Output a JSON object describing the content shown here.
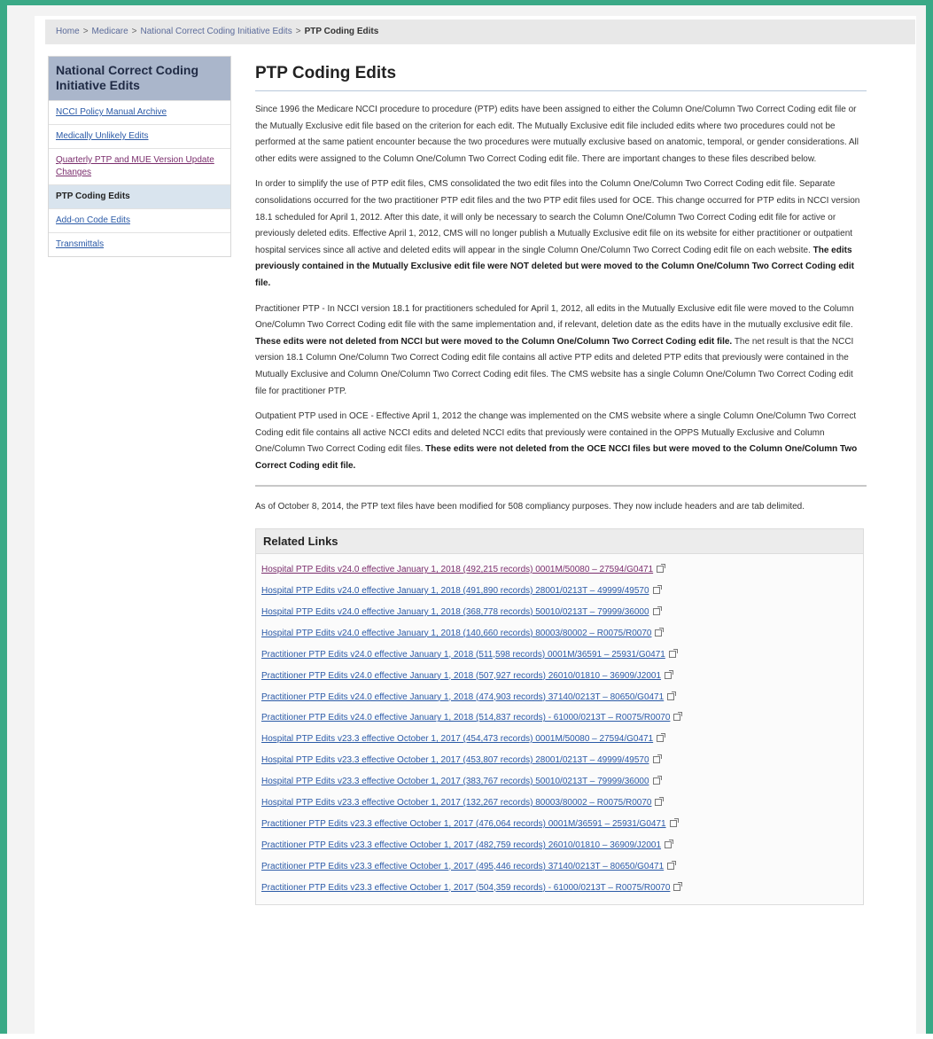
{
  "breadcrumb": {
    "home": "Home",
    "medicare": "Medicare",
    "ncci": "National Correct Coding Initiative Edits",
    "current": "PTP Coding Edits",
    "separator": ">"
  },
  "sidebar": {
    "heading": "National Correct Coding Initiative Edits",
    "items": [
      {
        "label": "NCCI Policy Manual Archive"
      },
      {
        "label": "Medically Unlikely Edits"
      },
      {
        "label": "Quarterly PTP and MUE Version Update Changes"
      },
      {
        "label": "PTP Coding Edits"
      },
      {
        "label": "Add-on Code Edits"
      },
      {
        "label": "Transmittals"
      }
    ]
  },
  "main": {
    "title": "PTP Coding Edits",
    "p1": "Since 1996 the Medicare NCCI procedure to procedure (PTP) edits have been assigned to either the Column One/Column Two Correct Coding edit file or the Mutually Exclusive edit file based on the criterion for each edit. The Mutually Exclusive edit file included edits where two procedures could not be performed at the same patient encounter because the two procedures were mutually exclusive based on anatomic, temporal, or gender considerations. All other edits were assigned to the Column One/Column Two Correct Coding edit file. There are important changes to these files described below.",
    "p2_text": "In order to simplify the use of PTP edit files, CMS consolidated the two edit files into the Column One/Column Two Correct Coding edit file. Separate consolidations occurred for the two practitioner PTP edit files and the two PTP edit files used for OCE. This change occurred for PTP edits in NCCI version 18.1 scheduled for April 1, 2012. After this date, it will only be necessary to search the Column One/Column Two Correct Coding edit file for active or previously deleted edits. Effective April 1, 2012, CMS will no longer publish a Mutually Exclusive edit file on its website for either practitioner or outpatient hospital services since all active and deleted edits will appear in the single Column One/Column Two Correct Coding edit file on each website.",
    "p2_bold": "The edits previously contained in the Mutually Exclusive edit file were NOT deleted but were moved to the Column One/Column Two Correct Coding edit file.",
    "p3_text1": "Practitioner PTP - In NCCI version 18.1 for practitioners scheduled for April 1, 2012, all edits in the Mutually Exclusive edit file were moved to the Column One/Column Two Correct Coding edit file with the same implementation and, if relevant, deletion date as the edits have in the mutually exclusive edit file.",
    "p3_bold": "These edits were not deleted from NCCI but were moved to the Column One/Column Two Correct Coding edit file.",
    "p3_text2": "The net result is that the NCCI version 18.1 Column One/Column Two Correct Coding edit file contains all active PTP edits and deleted PTP edits that previously were contained in the Mutually Exclusive and Column One/Column Two Correct Coding edit files. The CMS website has a single Column One/Column Two Correct Coding edit file for practitioner PTP.",
    "p4_text": "Outpatient PTP used in OCE - Effective April 1, 2012 the change was implemented on the CMS website where a single Column One/Column Two Correct Coding edit file contains all active NCCI edits and deleted NCCI edits that previously were contained in the OPPS Mutually Exclusive and Column One/Column Two Correct Coding edit files.",
    "p4_bold": "These edits were not deleted from the OCE NCCI files but were moved to the Column One/Column Two Correct Coding edit file.",
    "p5": "As of October 8, 2014, the PTP text files have been modified for 508 compliancy purposes. They now include headers and are tab delimited."
  },
  "related": {
    "heading": "Related Links",
    "links": [
      {
        "label": "Hospital PTP Edits v24.0 effective January 1, 2018 (492,215 records) 0001M/50080 – 27594/G0471",
        "visited": true
      },
      {
        "label": "Hospital PTP Edits v24.0 effective January 1, 2018 (491,890 records) 28001/0213T – 49999/49570",
        "visited": false
      },
      {
        "label": "Hospital PTP Edits v24.0 effective January 1, 2018 (368,778 records) 50010/0213T – 79999/36000",
        "visited": false
      },
      {
        "label": "Hospital PTP Edits v24.0 effective January 1, 2018 (140,660 records) 80003/80002 – R0075/R0070",
        "visited": false
      },
      {
        "label": "Practitioner PTP Edits v24.0 effective January 1, 2018 (511,598 records) 0001M/36591 – 25931/G0471",
        "visited": false
      },
      {
        "label": "Practitioner PTP Edits v24.0 effective January 1, 2018 (507,927 records) 26010/01810 – 36909/J2001",
        "visited": false
      },
      {
        "label": "Practitioner PTP Edits v24.0 effective January 1, 2018 (474,903 records) 37140/0213T – 80650/G0471",
        "visited": false
      },
      {
        "label": "Practitioner PTP Edits v24.0 effective January 1, 2018 (514,837 records) - 61000/0213T – R0075/R0070",
        "visited": false
      },
      {
        "label": "Hospital PTP Edits v23.3 effective October 1, 2017 (454,473 records) 0001M/50080 – 27594/G0471",
        "visited": false
      },
      {
        "label": "Hospital PTP Edits v23.3 effective October 1, 2017 (453,807 records) 28001/0213T – 49999/49570",
        "visited": false
      },
      {
        "label": "Hospital PTP Edits v23.3 effective October 1, 2017 (383,767 records) 50010/0213T – 79999/36000",
        "visited": false
      },
      {
        "label": "Hospital PTP Edits v23.3 effective October 1, 2017 (132,267 records) 80003/80002 – R0075/R0070",
        "visited": false
      },
      {
        "label": "Practitioner PTP Edits v23.3 effective October 1, 2017 (476,064 records) 0001M/36591 – 25931/G0471",
        "visited": false
      },
      {
        "label": "Practitioner PTP Edits v23.3 effective October 1, 2017 (482,759 records) 26010/01810 – 36909/J2001",
        "visited": false
      },
      {
        "label": "Practitioner PTP Edits v23.3 effective October 1, 2017 (495,446 records) 37140/0213T – 80650/G0471",
        "visited": false
      },
      {
        "label": "Practitioner PTP Edits v23.3 effective October 1, 2017 (504,359 records) - 61000/0213T – R0075/R0070",
        "visited": false
      }
    ]
  }
}
